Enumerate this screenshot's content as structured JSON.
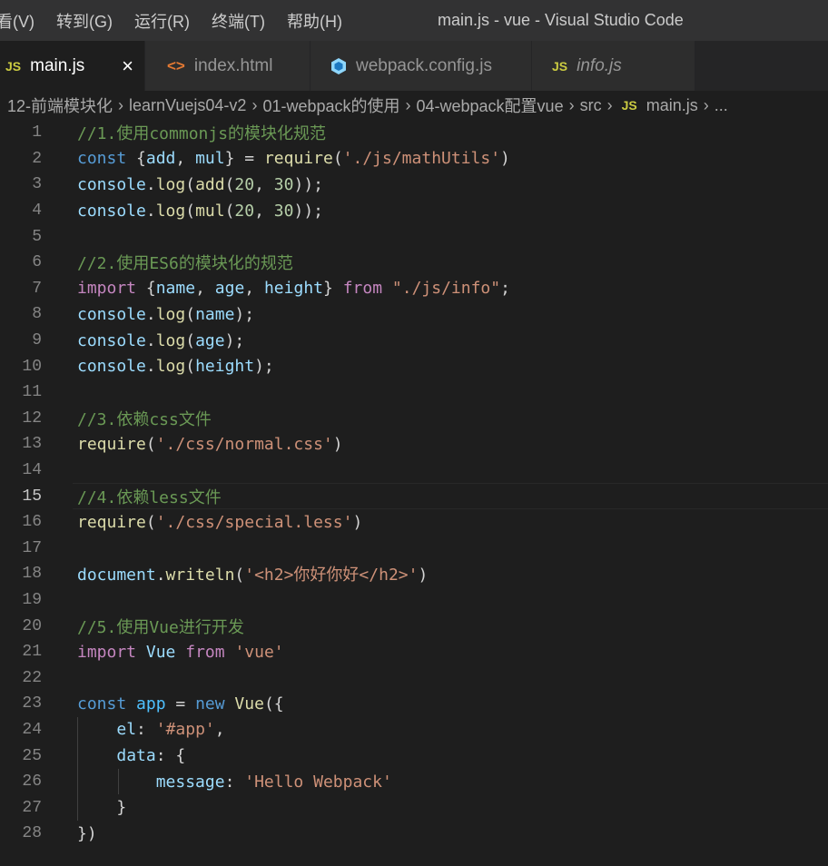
{
  "menu": [
    "看(V)",
    "转到(G)",
    "运行(R)",
    "终端(T)",
    "帮助(H)"
  ],
  "window_title": "main.js - vue - Visual Studio Code",
  "tabs": [
    {
      "label": "main.js",
      "icon": "js-icon",
      "active": true,
      "close": "×"
    },
    {
      "label": "index.html",
      "icon": "html-icon",
      "active": false
    },
    {
      "label": "webpack.config.js",
      "icon": "webpack-icon",
      "active": false
    },
    {
      "label": "info.js",
      "icon": "js-icon",
      "active": false,
      "italic": true
    }
  ],
  "icon_text": {
    "js": "JS",
    "html": "<>"
  },
  "breadcrumb": [
    "12-前端模块化",
    "learnVuejs04-v2",
    "01-webpack的使用",
    "04-webpack配置vue",
    "src",
    "main.js",
    "..."
  ],
  "colors": {
    "background": "#1e1e1e",
    "comment": "#6a9955",
    "keyword": "#569cd6",
    "control": "#c586c0",
    "function": "#dcdcaa",
    "variable": "#9cdcfe",
    "constant": "#4fc1ff",
    "string": "#ce9178",
    "number": "#b5cea8",
    "class": "#4ec9b0"
  },
  "editor": {
    "current_line": 15,
    "lines": [
      {
        "n": "1",
        "tokens": [
          [
            "c",
            "//1.使用commonjs的模块化规范"
          ]
        ]
      },
      {
        "n": "2",
        "tokens": [
          [
            "k",
            "const"
          ],
          [
            "p",
            " {"
          ],
          [
            "v",
            "add"
          ],
          [
            "p",
            ", "
          ],
          [
            "v",
            "mul"
          ],
          [
            "p",
            "} = "
          ],
          [
            "f",
            "require"
          ],
          [
            "p",
            "("
          ],
          [
            "s",
            "'./js/mathUtils'"
          ],
          [
            "p",
            ")"
          ]
        ]
      },
      {
        "n": "3",
        "tokens": [
          [
            "v",
            "console"
          ],
          [
            "p",
            "."
          ],
          [
            "f",
            "log"
          ],
          [
            "p",
            "("
          ],
          [
            "f",
            "add"
          ],
          [
            "p",
            "("
          ],
          [
            "num",
            "20"
          ],
          [
            "p",
            ", "
          ],
          [
            "num",
            "30"
          ],
          [
            "p",
            "));"
          ]
        ]
      },
      {
        "n": "4",
        "tokens": [
          [
            "v",
            "console"
          ],
          [
            "p",
            "."
          ],
          [
            "f",
            "log"
          ],
          [
            "p",
            "("
          ],
          [
            "f",
            "mul"
          ],
          [
            "p",
            "("
          ],
          [
            "num",
            "20"
          ],
          [
            "p",
            ", "
          ],
          [
            "num",
            "30"
          ],
          [
            "p",
            "));"
          ]
        ]
      },
      {
        "n": "5",
        "tokens": []
      },
      {
        "n": "6",
        "tokens": [
          [
            "c",
            "//2.使用ES6的模块化的规范"
          ]
        ]
      },
      {
        "n": "7",
        "tokens": [
          [
            "ctl",
            "import"
          ],
          [
            "p",
            " {"
          ],
          [
            "v",
            "name"
          ],
          [
            "p",
            ", "
          ],
          [
            "v",
            "age"
          ],
          [
            "p",
            ", "
          ],
          [
            "v",
            "height"
          ],
          [
            "p",
            "} "
          ],
          [
            "ctl",
            "from"
          ],
          [
            "p",
            " "
          ],
          [
            "s",
            "\"./js/info\""
          ],
          [
            "p",
            ";"
          ]
        ]
      },
      {
        "n": "8",
        "tokens": [
          [
            "v",
            "console"
          ],
          [
            "p",
            "."
          ],
          [
            "f",
            "log"
          ],
          [
            "p",
            "("
          ],
          [
            "v",
            "name"
          ],
          [
            "p",
            ");"
          ]
        ]
      },
      {
        "n": "9",
        "tokens": [
          [
            "v",
            "console"
          ],
          [
            "p",
            "."
          ],
          [
            "f",
            "log"
          ],
          [
            "p",
            "("
          ],
          [
            "v",
            "age"
          ],
          [
            "p",
            ");"
          ]
        ]
      },
      {
        "n": "10",
        "tokens": [
          [
            "v",
            "console"
          ],
          [
            "p",
            "."
          ],
          [
            "f",
            "log"
          ],
          [
            "p",
            "("
          ],
          [
            "v",
            "height"
          ],
          [
            "p",
            ");"
          ]
        ]
      },
      {
        "n": "11",
        "tokens": []
      },
      {
        "n": "12",
        "tokens": [
          [
            "c",
            "//3.依赖css文件"
          ]
        ]
      },
      {
        "n": "13",
        "tokens": [
          [
            "f",
            "require"
          ],
          [
            "p",
            "("
          ],
          [
            "s",
            "'./css/normal.css'"
          ],
          [
            "p",
            ")"
          ]
        ]
      },
      {
        "n": "14",
        "tokens": []
      },
      {
        "n": "15",
        "tokens": [
          [
            "c",
            "//4.依赖less文件"
          ]
        ]
      },
      {
        "n": "16",
        "tokens": [
          [
            "f",
            "require"
          ],
          [
            "p",
            "("
          ],
          [
            "s",
            "'./css/special.less'"
          ],
          [
            "p",
            ")"
          ]
        ]
      },
      {
        "n": "17",
        "tokens": []
      },
      {
        "n": "18",
        "tokens": [
          [
            "v",
            "document"
          ],
          [
            "p",
            "."
          ],
          [
            "f",
            "writeln"
          ],
          [
            "p",
            "("
          ],
          [
            "s",
            "'<h2>你好你好</h2>'"
          ],
          [
            "p",
            ")"
          ]
        ]
      },
      {
        "n": "19",
        "tokens": []
      },
      {
        "n": "20",
        "tokens": [
          [
            "c",
            "//5.使用Vue进行开发"
          ]
        ]
      },
      {
        "n": "21",
        "tokens": [
          [
            "ctl",
            "import"
          ],
          [
            "p",
            " "
          ],
          [
            "v",
            "Vue"
          ],
          [
            "p",
            " "
          ],
          [
            "ctl",
            "from"
          ],
          [
            "p",
            " "
          ],
          [
            "s",
            "'vue'"
          ]
        ]
      },
      {
        "n": "22",
        "tokens": []
      },
      {
        "n": "23",
        "tokens": [
          [
            "k",
            "const"
          ],
          [
            "p",
            " "
          ],
          [
            "const",
            "app"
          ],
          [
            "p",
            " = "
          ],
          [
            "k",
            "new"
          ],
          [
            "p",
            " "
          ],
          [
            "f",
            "Vue"
          ],
          [
            "p",
            "({"
          ]
        ]
      },
      {
        "n": "24",
        "tokens": [
          [
            "p",
            "    "
          ],
          [
            "v",
            "el"
          ],
          [
            "p",
            ": "
          ],
          [
            "s",
            "'#app'"
          ],
          [
            "p",
            ","
          ]
        ]
      },
      {
        "n": "25",
        "tokens": [
          [
            "p",
            "    "
          ],
          [
            "v",
            "data"
          ],
          [
            "p",
            ": {"
          ]
        ]
      },
      {
        "n": "26",
        "tokens": [
          [
            "p",
            "        "
          ],
          [
            "v",
            "message"
          ],
          [
            "p",
            ": "
          ],
          [
            "s",
            "'Hello Webpack'"
          ]
        ]
      },
      {
        "n": "27",
        "tokens": [
          [
            "p",
            "    }"
          ]
        ]
      },
      {
        "n": "28",
        "tokens": [
          [
            "p",
            "})"
          ]
        ]
      }
    ]
  }
}
